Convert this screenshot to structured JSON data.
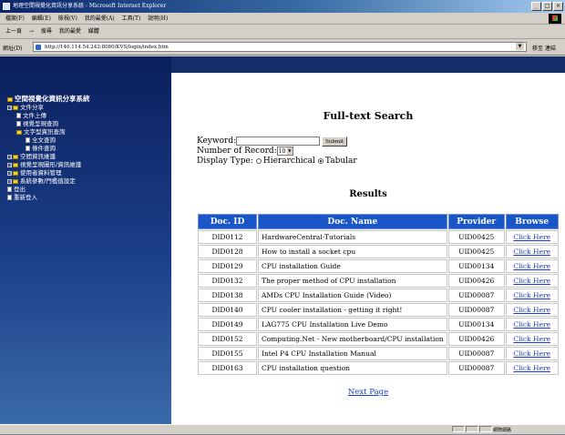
{
  "window": {
    "title": "地理空間視覺化資訊分享系統 - Microsoft Internet Explorer",
    "controls": [
      "_",
      "□",
      "×"
    ]
  },
  "menubar": [
    "檔案(F)",
    "編輯(E)",
    "檢視(V)",
    "我的最愛(A)",
    "工具(T)",
    "說明(H)"
  ],
  "toolbar": [
    "上一頁",
    "→",
    "搜尋",
    "我的最愛",
    "媒體"
  ],
  "address": {
    "label": "網址(D)",
    "url": "http://140.114.54.243:8080/KVS/login/index.htm",
    "go": "移至",
    "links": "連結"
  },
  "sidebar": {
    "root": "空間視覺化資訊分享系統",
    "items": [
      {
        "label": "文件分享",
        "level": 1,
        "icon": "folder"
      },
      {
        "label": "文件上傳",
        "level": 2,
        "icon": "page"
      },
      {
        "label": "視覺呈現查詢",
        "level": 2,
        "icon": "page"
      },
      {
        "label": "文字型資訊查詢",
        "level": 2,
        "icon": "folder"
      },
      {
        "label": "全文查詢",
        "level": 3,
        "icon": "page"
      },
      {
        "label": "條件查詢",
        "level": 3,
        "icon": "page"
      },
      {
        "label": "空間資訊維護",
        "level": 1,
        "icon": "folder"
      },
      {
        "label": "視覺呈現圖形/資訊維護",
        "level": 1,
        "icon": "folder"
      },
      {
        "label": "使用者資料管理",
        "level": 1,
        "icon": "folder"
      },
      {
        "label": "系統參數/門檻值設定",
        "level": 1,
        "icon": "folder"
      },
      {
        "label": "登出",
        "level": 1,
        "icon": "page"
      },
      {
        "label": "重新登入",
        "level": 1,
        "icon": "page"
      }
    ]
  },
  "search": {
    "heading": "Full-text Search",
    "keyword_label": "Keyword:",
    "keyword_value": "",
    "submit_label": "Submit",
    "records_label": "Number of Record:",
    "records_value": "10",
    "display_label": "Display Type:",
    "option_hierarchical": "Hierarchical",
    "option_tabular": "Tabular",
    "selected": "Tabular"
  },
  "results": {
    "heading": "Results",
    "columns": [
      "Doc. ID",
      "Doc. Name",
      "Provider",
      "Browse"
    ],
    "rows": [
      {
        "id": "DID0112",
        "name": "HardwareCentral-Tutorials",
        "provider": "UID00425",
        "browse": "Click Here"
      },
      {
        "id": "DID0128",
        "name": "How to install a socket cpu",
        "provider": "UID00425",
        "browse": "Click Here"
      },
      {
        "id": "DID0129",
        "name": "CPU installation Guide",
        "provider": "UID00134",
        "browse": "Click Here"
      },
      {
        "id": "DID0132",
        "name": "The proper method of CPU installation",
        "provider": "UID00426",
        "browse": "Click Here"
      },
      {
        "id": "DID0138",
        "name": "AMDs CPU Installation Guide (Video)",
        "provider": "UID00087",
        "browse": "Click Here"
      },
      {
        "id": "DID0140",
        "name": "CPU cooler installation - getting it right!",
        "provider": "UID00087",
        "browse": "Click Here"
      },
      {
        "id": "DID0149",
        "name": "LAG775 CPU Installation Live Demo",
        "provider": "UID00134",
        "browse": "Click Here"
      },
      {
        "id": "DID0152",
        "name": "Computing.Net - New motherboard/CPU installation",
        "provider": "UID00426",
        "browse": "Click Here"
      },
      {
        "id": "DID0155",
        "name": "Intel P4 CPU Installation Manual",
        "provider": "UID00087",
        "browse": "Click Here"
      },
      {
        "id": "DID0163",
        "name": "CPU installation question",
        "provider": "UID00087",
        "browse": "Click Here"
      }
    ],
    "next_page": "Next Page"
  },
  "status": {
    "zone": "網際網路"
  }
}
